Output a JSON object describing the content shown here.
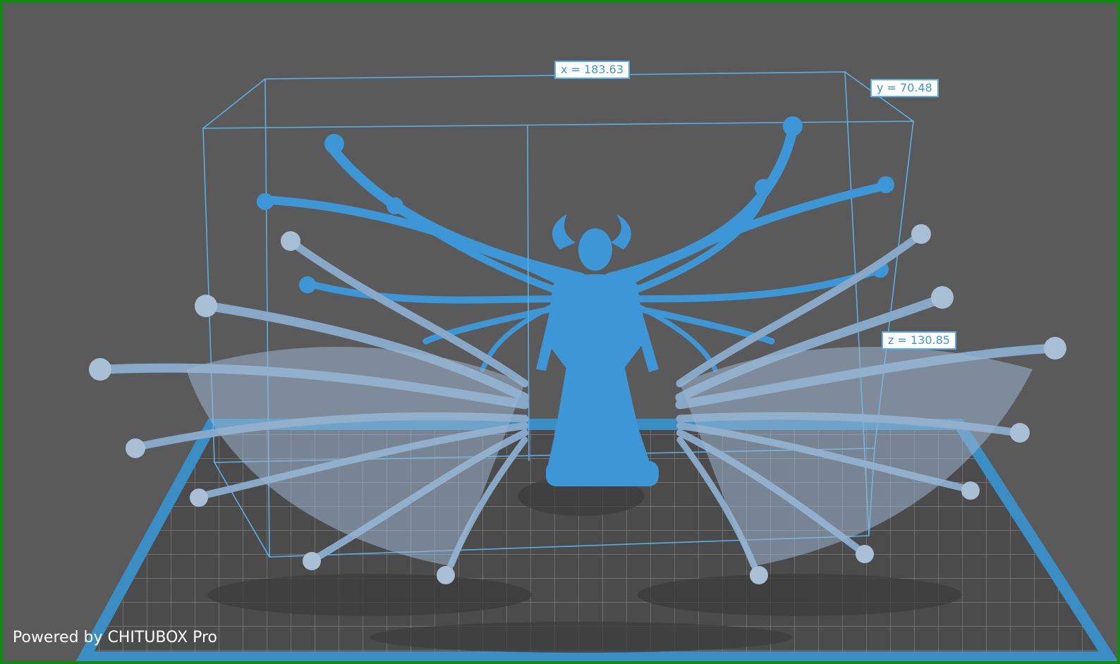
{
  "viewport": {
    "name": "3D model viewport",
    "background_color": "#5a5a5a",
    "border_color": "#138a13",
    "model_color": "#3d97d6",
    "wing_color": "#88a8c8",
    "bounding_box_color": "#5aaee6",
    "build_plate_color": "#3a8ec4"
  },
  "dimensions": {
    "x_label": "x = 183.63",
    "y_label": "y = 70.48",
    "z_label": "z = 130.85"
  },
  "watermark": "Powered by CHITUBOX Pro"
}
